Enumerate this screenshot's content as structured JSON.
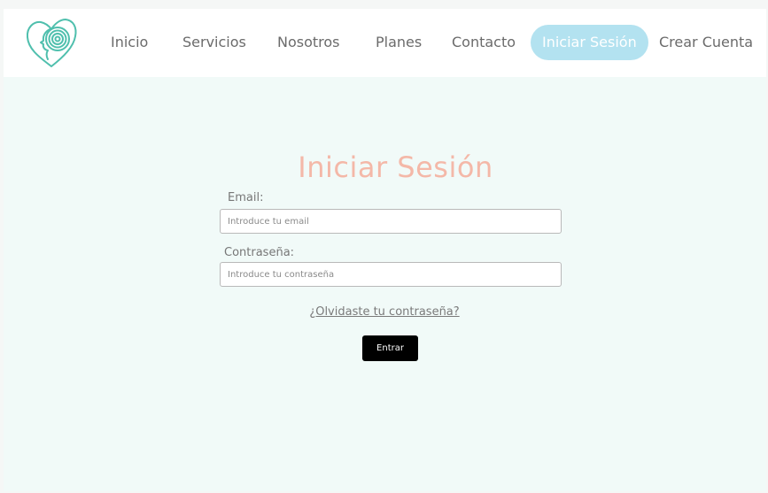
{
  "nav": {
    "logo_icon": "heart-spiral-head-logo",
    "items": [
      {
        "label": "Inicio"
      },
      {
        "label": "Servicios"
      },
      {
        "label": "Nosotros"
      },
      {
        "label": "Planes"
      },
      {
        "label": "Contacto"
      },
      {
        "label": "Iniciar Sesión",
        "active": true
      },
      {
        "label": "Crear Cuenta"
      }
    ]
  },
  "login": {
    "title": "Iniciar Sesión",
    "email_label": "Email:",
    "email_placeholder": "Introduce tu email",
    "password_label": "Contraseña:",
    "password_placeholder": "Introduce tu contraseña",
    "forgot_link": "¿Olvidaste tu contraseña?",
    "submit_label": "Entrar"
  },
  "colors": {
    "logo_teal": "#4fbfad",
    "title_peach": "#f4b8a8",
    "active_pill": "#b3e2f0",
    "page_background": "#f1faf8",
    "button_black": "#000000"
  }
}
